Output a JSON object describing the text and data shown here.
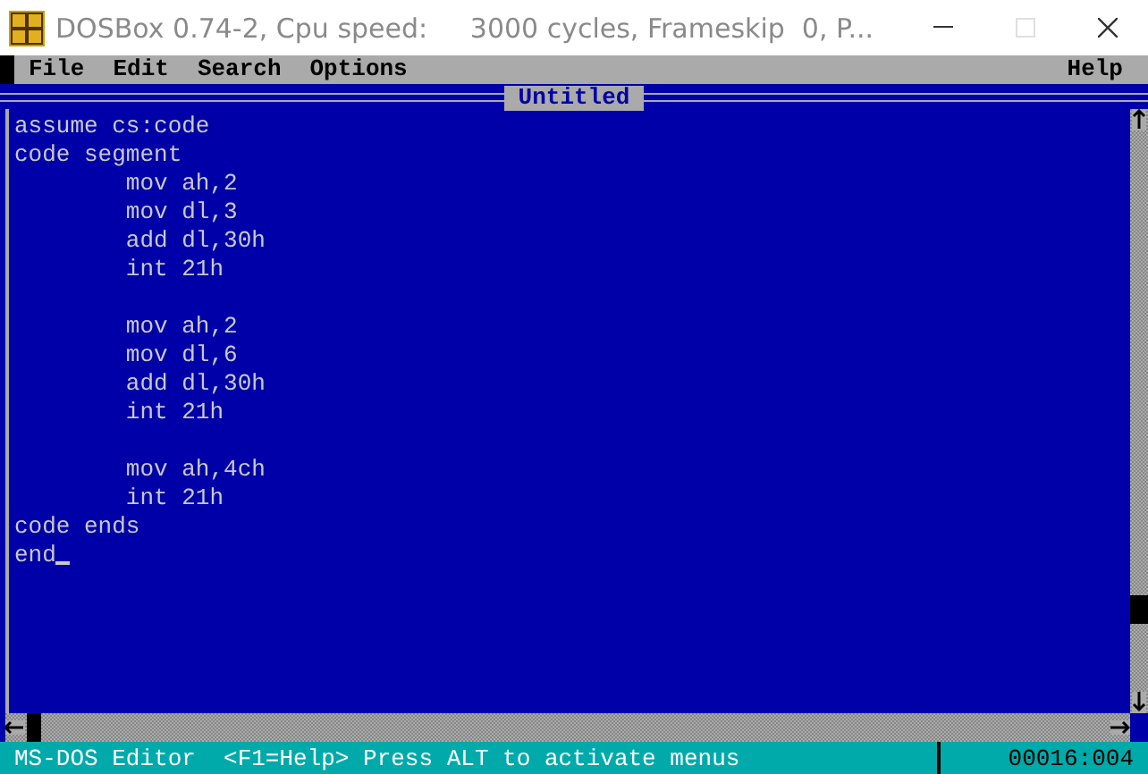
{
  "window": {
    "title": "DOSBox 0.74-2, Cpu speed:     3000 cycles, Frameskip  0, P...",
    "buttons": [
      {
        "kind": "minimize",
        "disabled": false
      },
      {
        "kind": "maximize",
        "disabled": true
      },
      {
        "kind": "close",
        "disabled": false
      }
    ]
  },
  "menu": {
    "items": [
      "File",
      "Edit",
      "Search",
      "Options"
    ],
    "help": "Help"
  },
  "editor": {
    "title": "Untitled",
    "cursor": true,
    "blocks": [
      [
        "assume cs:code",
        "code segment",
        "        mov ah,2",
        "        mov dl,3",
        "        add dl,30h",
        "        int 21h"
      ],
      [
        "        mov ah,2",
        "        mov dl,6",
        "        add dl,30h",
        "        int 21h"
      ],
      [
        "        mov ah,4ch",
        "        int 21h",
        "code ends",
        "end"
      ]
    ]
  },
  "status_bar": {
    "message": "MS-DOS Editor  <F1=Help> Press ALT to activate menus",
    "position": "00016:004"
  }
}
